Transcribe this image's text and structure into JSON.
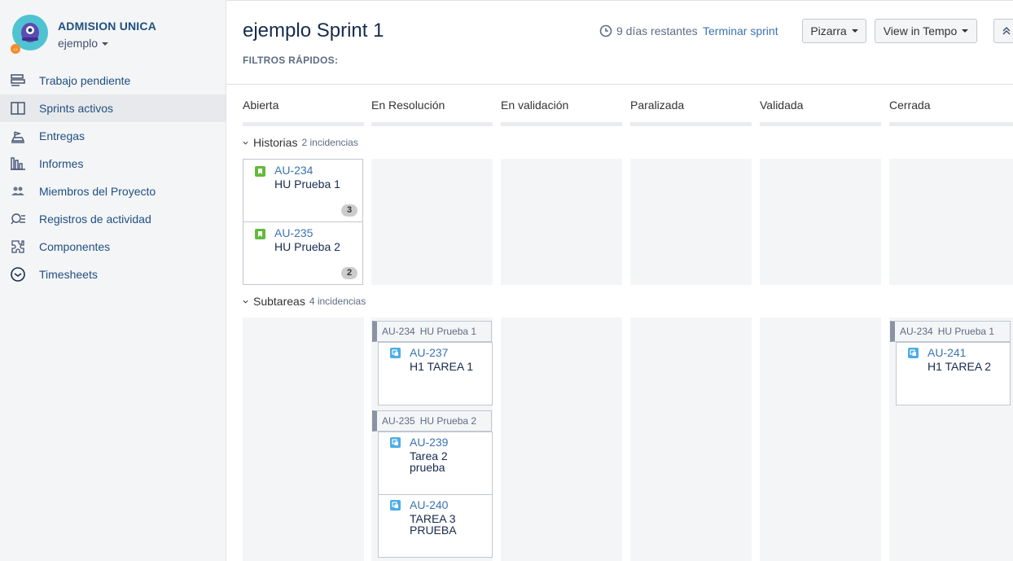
{
  "sidebar": {
    "project_name": "ADMISION UNICA",
    "board_name": "ejemplo",
    "items": [
      {
        "label": "Trabajo pendiente",
        "icon": "backlog-icon"
      },
      {
        "label": "Sprints activos",
        "icon": "active-sprints-icon",
        "active": true
      },
      {
        "label": "Entregas",
        "icon": "releases-icon"
      },
      {
        "label": "Informes",
        "icon": "reports-icon"
      },
      {
        "label": "Miembros del Proyecto",
        "icon": "members-icon"
      },
      {
        "label": "Registros de actividad",
        "icon": "activity-log-icon"
      },
      {
        "label": "Componentes",
        "icon": "components-icon"
      },
      {
        "label": "Timesheets",
        "icon": "timesheets-icon"
      }
    ]
  },
  "header": {
    "title": "ejemplo Sprint 1",
    "quick_filters": "FILTROS RÁPIDOS:",
    "remaining": "9 días restantes",
    "finish_sprint": "Terminar sprint",
    "board_button": "Pizarra",
    "tempo_button": "View in Tempo"
  },
  "columns": [
    "Abierta",
    "En Resolución",
    "En validación",
    "Paralizada",
    "Validada",
    "Cerrada"
  ],
  "swimlanes": {
    "stories": {
      "title": "Historias",
      "count": "2 incidencias"
    },
    "subtasks": {
      "title": "Subtareas",
      "count": "4 incidencias"
    }
  },
  "stories": [
    {
      "key": "AU-234",
      "summary": "HU Prueba 1",
      "badge": "3"
    },
    {
      "key": "AU-235",
      "summary": "HU Prueba 2",
      "badge": "2"
    }
  ],
  "subtask_groups": [
    {
      "parent_key": "AU-234",
      "parent_summary": "HU Prueba 1",
      "column": "En Resolución",
      "subtasks": [
        {
          "key": "AU-237",
          "summary": "H1 TAREA 1"
        }
      ]
    },
    {
      "parent_key": "AU-235",
      "parent_summary": "HU Prueba 2",
      "column": "En Resolución",
      "subtasks": [
        {
          "key": "AU-239",
          "summary": "Tarea 2 prueba"
        },
        {
          "key": "AU-240",
          "summary": "TAREA 3 PRUEBA"
        }
      ]
    },
    {
      "parent_key": "AU-234",
      "parent_summary": "HU Prueba 1",
      "column": "Cerrada",
      "subtasks": [
        {
          "key": "AU-241",
          "summary": "H1 TAREA 2"
        }
      ]
    }
  ],
  "colors": {
    "link": "#3b73af",
    "story": "#63ba3c",
    "subtask": "#4bade8",
    "sidebar_bg": "#f4f5f7"
  }
}
